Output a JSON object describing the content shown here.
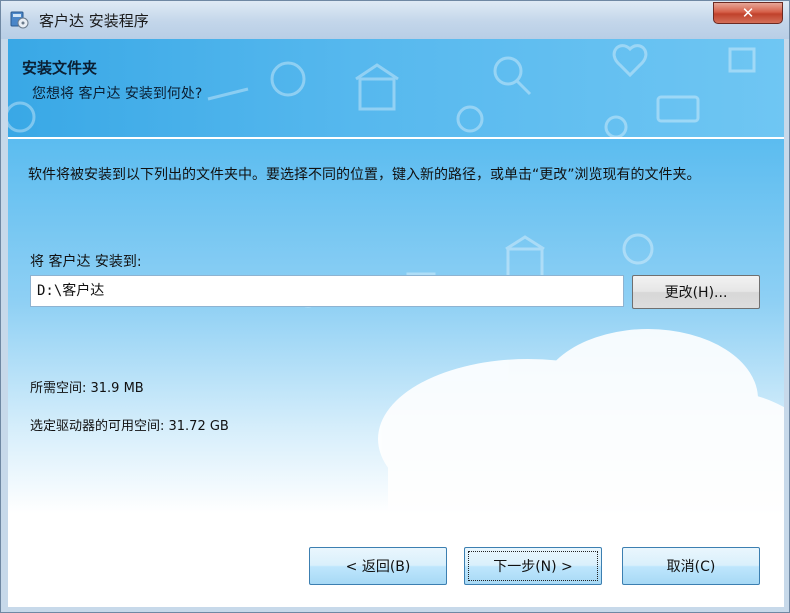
{
  "window": {
    "title": "客户达 安装程序",
    "close_label": "✕"
  },
  "header": {
    "title": "安装文件夹",
    "subtitle": "您想将 客户达 安装到何处?"
  },
  "main": {
    "description": "软件将被安装到以下列出的文件夹中。要选择不同的位置，键入新的路径，或单击“更改”浏览现有的文件夹。",
    "install_to_label": "将 客户达 安装到:",
    "install_path": "D:\\客户达",
    "change_button": "更改(H)...",
    "required_space": "所需空间: 31.9 MB",
    "available_space": "选定驱动器的可用空间: 31.72 GB"
  },
  "footer": {
    "back_button": "< 返回(B)",
    "next_button": "下一步(N) >",
    "cancel_button": "取消(C)"
  }
}
